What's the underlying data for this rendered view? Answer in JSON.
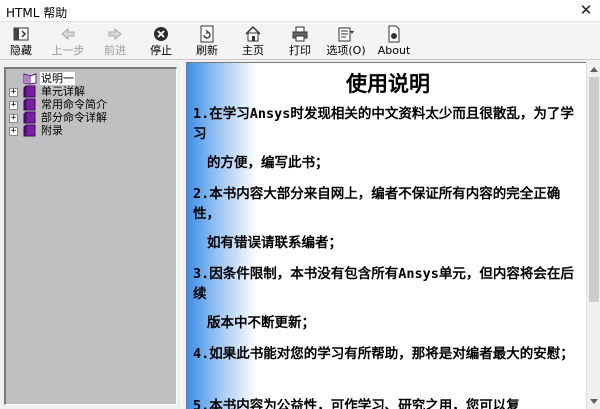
{
  "window": {
    "title": "HTML 帮助",
    "close_glyph": "✕"
  },
  "toolbar": {
    "items": [
      {
        "label": "隐藏",
        "icon": "hide-pane-icon",
        "enabled": true
      },
      {
        "label": "上一步",
        "icon": "back-arrow-icon",
        "enabled": false
      },
      {
        "label": "前进",
        "icon": "forward-arrow-icon",
        "enabled": false
      },
      {
        "label": "停止",
        "icon": "stop-icon",
        "enabled": true
      },
      {
        "label": "刷新",
        "icon": "refresh-icon",
        "enabled": true
      },
      {
        "label": "主页",
        "icon": "home-icon",
        "enabled": true
      },
      {
        "label": "打印",
        "icon": "print-icon",
        "enabled": true
      },
      {
        "label": "选项(O)",
        "icon": "options-icon",
        "enabled": true
      },
      {
        "label": "About",
        "icon": "about-icon",
        "enabled": true
      }
    ]
  },
  "tree": {
    "nodes": [
      {
        "label": "说明一",
        "expander": "",
        "icon": "open-book-icon",
        "selected": true
      },
      {
        "label": "单元详解",
        "expander": "+",
        "icon": "closed-book-icon"
      },
      {
        "label": "常用命令简介",
        "expander": "+",
        "icon": "closed-book-icon"
      },
      {
        "label": "部分命令详解",
        "expander": "+",
        "icon": "closed-book-icon"
      },
      {
        "label": "附录",
        "expander": "+",
        "icon": "closed-book-icon"
      }
    ]
  },
  "content": {
    "heading": "使用说明",
    "paragraphs": [
      {
        "text": "1.在学习Ansys时发现相关的中文资料太少而且很散乱，为了学习",
        "indent": false
      },
      {
        "text": "的方便，编写此书；",
        "indent": true
      },
      {
        "text": "2.本书内容大部分来自网上，编者不保证所有内容的完全正确性，",
        "indent": false
      },
      {
        "text": "如有错误请联系编者；",
        "indent": true
      },
      {
        "text": "3.因条件限制，本书没有包含所有Ansys单元，但内容将会在后续",
        "indent": false
      },
      {
        "text": "版本中不断更新；",
        "indent": true
      },
      {
        "text": "4.如果此书能对您的学习有所帮助，那将是对编者最大的安慰；",
        "indent": false
      },
      {
        "text": "5.本书内容为公益性，可作学习、研究之用，您可以复",
        "indent": false
      }
    ]
  },
  "colors": {
    "sidebar_gradient": "#3d8fe8",
    "tree_background": "#c0c0c0",
    "book_purple": "#7b1fa2"
  }
}
